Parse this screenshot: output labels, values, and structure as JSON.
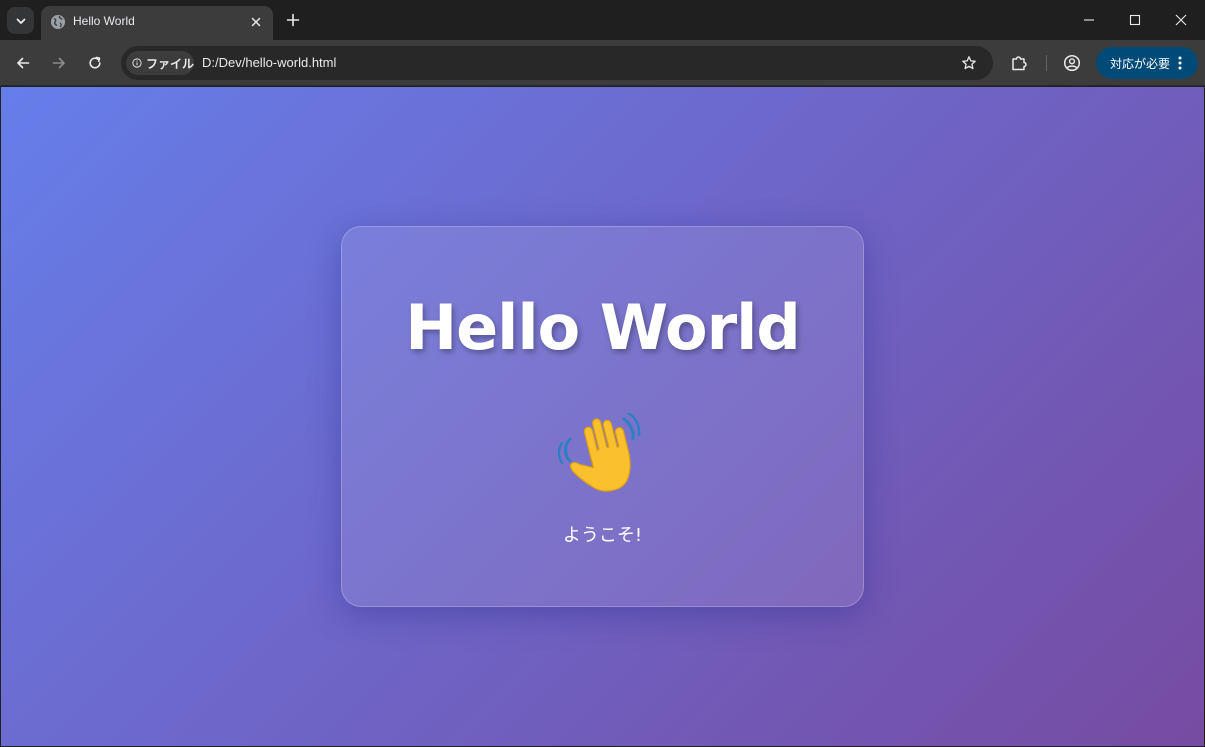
{
  "browser": {
    "tab": {
      "title": "Hello World",
      "favicon": "globe-icon"
    },
    "omnibox": {
      "site_chip_label": "ファイル",
      "url": "D:/Dev/hello-world.html"
    },
    "update_button_label": "対応が必要"
  },
  "page": {
    "heading": "Hello World",
    "emoji": "👋",
    "message": "ようこそ!",
    "colors": {
      "gradient_start": "#667eea",
      "gradient_end": "#764ba2"
    }
  }
}
